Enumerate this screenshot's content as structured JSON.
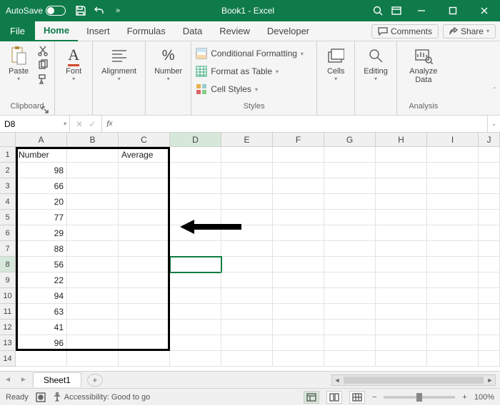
{
  "title": {
    "autosave": "AutoSave",
    "book": "Book1 - Excel"
  },
  "tabs": {
    "file": "File",
    "home": "Home",
    "insert": "Insert",
    "formulas": "Formulas",
    "data": "Data",
    "review": "Review",
    "developer": "Developer",
    "comments": "Comments",
    "share": "Share"
  },
  "ribbon": {
    "clipboard": {
      "paste": "Paste",
      "label": "Clipboard"
    },
    "font": {
      "btn": "Font"
    },
    "alignment": {
      "btn": "Alignment"
    },
    "number": {
      "btn": "Number"
    },
    "styles": {
      "cond": "Conditional Formatting",
      "table": "Format as Table",
      "cellstyles": "Cell Styles",
      "label": "Styles"
    },
    "cells": {
      "btn": "Cells"
    },
    "editing": {
      "btn": "Editing"
    },
    "analysis": {
      "btn": "Analyze Data",
      "label": "Analysis"
    }
  },
  "namebox": {
    "value": "D8"
  },
  "columns": [
    "A",
    "B",
    "C",
    "D",
    "E",
    "F",
    "G",
    "H",
    "I",
    "J"
  ],
  "sheet": {
    "header_a": "Number",
    "header_c": "Average",
    "values": [
      "98",
      "66",
      "20",
      "77",
      "29",
      "88",
      "56",
      "22",
      "94",
      "63",
      "41",
      "96"
    ],
    "tab": "Sheet1"
  },
  "status": {
    "ready": "Ready",
    "accessibility": "Accessibility: Good to go",
    "zoom": "100%"
  },
  "glyph": {
    "minus": "−",
    "plus": "+",
    "chevron": "»",
    "caret_down": "▾",
    "arrow_l": "◄",
    "arrow_r": "►",
    "x": "✕",
    "check": "✓"
  }
}
